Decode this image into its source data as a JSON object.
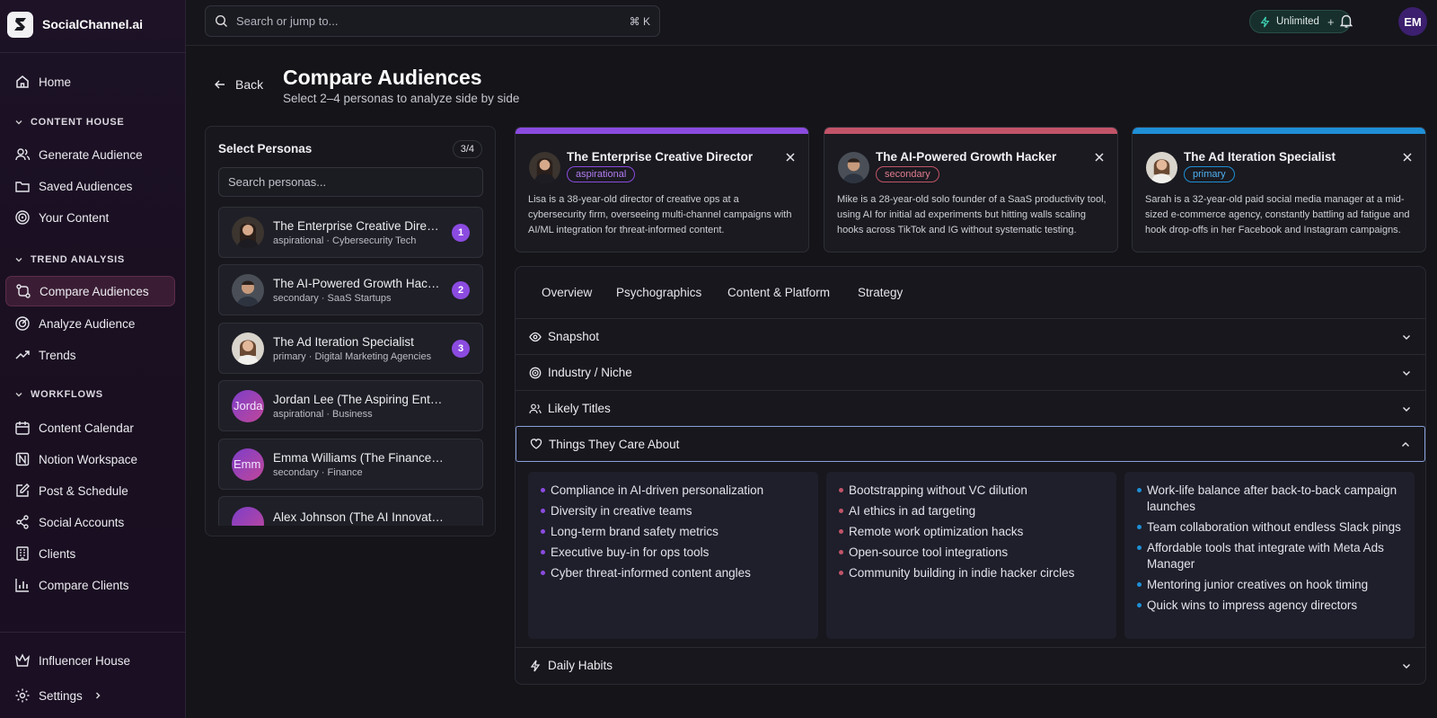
{
  "app": {
    "name": "SocialChannel.ai"
  },
  "sidebar": {
    "home": "Home",
    "sections": [
      {
        "title": "CONTENT HOUSE",
        "items": [
          "Generate Audience",
          "Saved Audiences",
          "Your Content"
        ]
      },
      {
        "title": "TREND ANALYSIS",
        "items": [
          "Compare Audiences",
          "Analyze Audience",
          "Trends"
        ]
      },
      {
        "title": "WORKFLOWS",
        "items": [
          "Content Calendar",
          "Notion Workspace",
          "Post & Schedule",
          "Social Accounts",
          "Clients",
          "Compare Clients"
        ]
      }
    ],
    "active_item": "Compare Audiences",
    "bottom": {
      "influencer": "Influencer House",
      "settings": "Settings"
    }
  },
  "topbar": {
    "search_placeholder": "Search or jump to...",
    "shortcut": "⌘ K",
    "plan_label": "Unlimited",
    "plan_plus": "+",
    "avatar_initials": "EM"
  },
  "header": {
    "back": "Back",
    "title": "Compare Audiences",
    "subtitle": "Select 2–4 personas to analyze side by side"
  },
  "persona_panel": {
    "title": "Select Personas",
    "count": "3/4",
    "search_placeholder": "Search personas...",
    "items": [
      {
        "name": "The Enterprise Creative Director",
        "meta": "aspirational · Cybersecurity Tech",
        "badge": "1"
      },
      {
        "name": "The AI-Powered Growth Hacker",
        "meta": "secondary · SaaS Startups",
        "badge": "2"
      },
      {
        "name": "The Ad Iteration Specialist",
        "meta": "primary · Digital Marketing Agencies",
        "badge": "3"
      },
      {
        "name": "Jordan Lee (The Aspiring Entrepreneur)",
        "meta": "aspirational · Business",
        "avatar_text": "Jorda"
      },
      {
        "name": "Emma Williams (The Finance Enthusiast)",
        "meta": "secondary · Finance",
        "avatar_text": "Emm"
      },
      {
        "name": "Alex Johnson (The AI Innovator)",
        "meta": ""
      }
    ]
  },
  "selected": [
    {
      "title": "The Enterprise Creative Director",
      "tag": "aspirational",
      "color": "#8b4be0",
      "desc": "Lisa is a 38-year-old director of creative ops at a cybersecurity firm, overseeing multi-channel campaigns with AI/ML integration for threat-informed content."
    },
    {
      "title": "The AI-Powered Growth Hacker",
      "tag": "secondary",
      "color": "#c25468",
      "desc": "Mike is a 28-year-old solo founder of a SaaS productivity tool, using AI for initial ad experiments but hitting walls scaling hooks across TikTok and IG without systematic testing."
    },
    {
      "title": "The Ad Iteration Specialist",
      "tag": "primary",
      "color": "#1f8fd6",
      "desc": "Sarah is a 32-year-old paid social media manager at a mid-sized e-commerce agency, constantly battling ad fatigue and hook drop-offs in her Facebook and Instagram campaigns."
    }
  ],
  "tabs": [
    "Overview",
    "Psychographics",
    "Content & Platform",
    "Strategy"
  ],
  "sections": {
    "snapshot": "Snapshot",
    "industry": "Industry / Niche",
    "titles": "Likely Titles",
    "care": "Things They Care About",
    "habits": "Daily Habits"
  },
  "care_columns": [
    [
      "Compliance in AI-driven personalization",
      "Diversity in creative teams",
      "Long-term brand safety metrics",
      "Executive buy-in for ops tools",
      "Cyber threat-informed content angles"
    ],
    [
      "Bootstrapping without VC dilution",
      "AI ethics in ad targeting",
      "Remote work optimization hacks",
      "Open-source tool integrations",
      "Community building in indie hacker circles"
    ],
    [
      "Work-life balance after back-to-back campaign launches",
      "Team collaboration without endless Slack pings",
      "Affordable tools that integrate with Meta Ads Manager",
      "Mentoring junior creatives on hook timing",
      "Quick wins to impress agency directors"
    ]
  ],
  "colors": {
    "accent": "#8b4be0",
    "secondary": "#c25468",
    "primary": "#1f8fd6"
  }
}
